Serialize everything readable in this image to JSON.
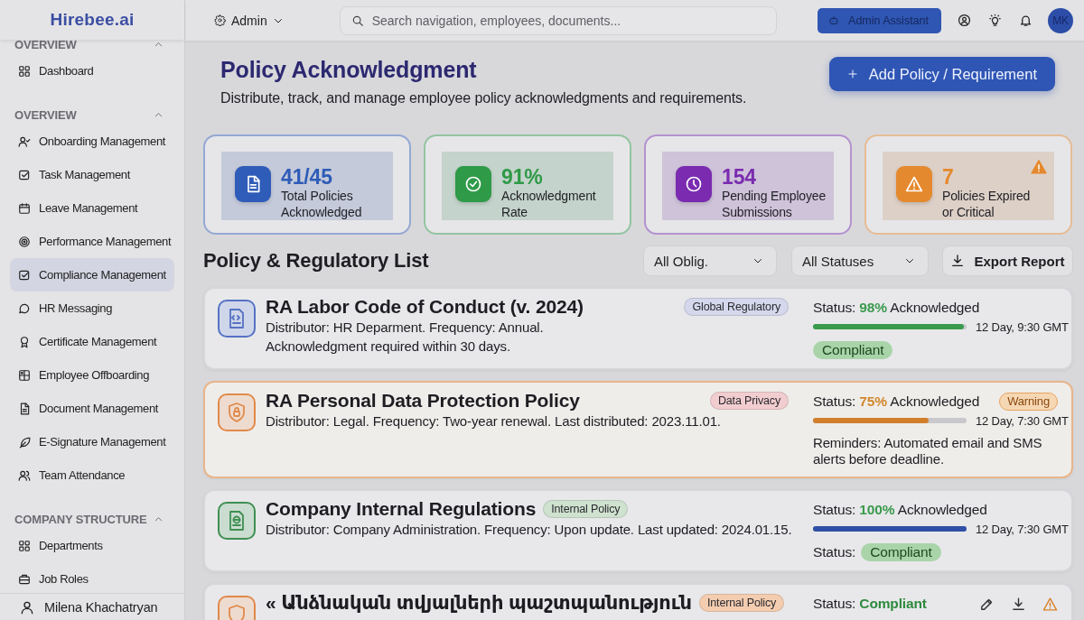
{
  "sidebar": {
    "logo": "Hirebee.ai",
    "sections": [
      {
        "title": "OVERVIEW",
        "expanded": true,
        "items": [
          {
            "label": "Dashboard",
            "selected": false
          }
        ]
      },
      {
        "title": "OVERVIEW",
        "expanded": true,
        "items": [
          {
            "label": "Onboarding Management",
            "selected": false
          },
          {
            "label": "Task Management",
            "selected": false
          },
          {
            "label": "Leave Management",
            "selected": false
          },
          {
            "label": "Performance Management",
            "selected": false
          },
          {
            "label": "Compliance Management",
            "selected": true
          },
          {
            "label": "HR Messaging",
            "selected": false
          },
          {
            "label": "Certificate Management",
            "selected": false
          },
          {
            "label": "Employee Offboarding",
            "selected": false
          },
          {
            "label": "Document Management",
            "selected": false
          },
          {
            "label": "E-Signature Management",
            "selected": false
          },
          {
            "label": "Team Attendance",
            "selected": false
          }
        ]
      },
      {
        "title": "COMPANY STRUCTURE",
        "expanded": true,
        "items": [
          {
            "label": "Departments",
            "selected": false
          },
          {
            "label": "Job Roles",
            "selected": false
          }
        ]
      }
    ],
    "user": "Milena Khachatryan"
  },
  "topbar": {
    "role": "Admin",
    "search": {
      "placeholder": "Search navigation, employees, documents..."
    },
    "assistant_button": "Admin Assistant",
    "avatar": "MK"
  },
  "header": {
    "title": "Policy Acknowledgment",
    "subtitle": "Distribute, track, and manage employee policy acknowledgments and requirements.",
    "add_button": "Add Policy / Requirement"
  },
  "stats": [
    {
      "kind": "document",
      "color": "#2f5cb8",
      "value": "41/45",
      "label": "Total Policies\nAcknowledged",
      "alert": false
    },
    {
      "kind": "check",
      "color": "#2f9a48",
      "value": "91%",
      "label": "Acknowledgment\nRate",
      "alert": false
    },
    {
      "kind": "clock",
      "color": "#7a2bb0",
      "value": "154",
      "label": "Pending Employee\nSubmissions",
      "alert": false
    },
    {
      "kind": "warning",
      "color": "#e5892e",
      "value": "7",
      "label": "Policies Expired\nor Critical",
      "alert": true
    }
  ],
  "list": {
    "title": "Policy & Regulatory List",
    "filters": [
      "All Oblig.",
      "All Statuses"
    ],
    "export_button": "Export Report",
    "policies": [
      {
        "kind": "code",
        "color": "#5572c4",
        "highlighted": false,
        "title": "RA Labor Code of Conduct (v. 2024)",
        "tag": {
          "label": "Global Regulatory",
          "color": "#d5d8ec",
          "inline": false
        },
        "description": "Distributor: HR Deparment. Frequency: Annual.\nAcknowledgment required within 30 days.",
        "status": {
          "text": "Status: **98%** Acknowledged",
          "color": "#3a9a4c"
        },
        "actions": false,
        "progress": {
          "level": 0.98,
          "color": "#3a9a4c"
        },
        "time": "12 Day, 9:30 GMT",
        "pill": "Compliant"
      },
      {
        "kind": "lock",
        "color": "#e08a4a",
        "highlighted": true,
        "title": "RA Personal Data Protection Policy",
        "tag": {
          "label": "Data Privacy",
          "color": "#f1cdd0",
          "inline": false
        },
        "description": "Distributor: Legal. Frequency: Two-year renewal. Last distributed: 2023.11.01.",
        "status": {
          "text": "Status: **75%** Acknowledged",
          "color": "#d0872c"
        },
        "badge": "Warning",
        "actions": false,
        "progress": {
          "level": 0.75,
          "color": "#d27f2c"
        },
        "time": "12 Day, 7:30 GMT",
        "note": "Reminders: Automated email and SMS\nalerts before deadline."
      },
      {
        "kind": "globe",
        "color": "#3f8f52",
        "highlighted": false,
        "title": "Company Internal Regulations",
        "tag": {
          "label": "Internal Policy",
          "color": "#cfe2cf",
          "inline": true
        },
        "description": "Distributor: Company Administration. Frequency: Upon update. Last updated: 2024.01.15.",
        "status": {
          "text": "Status: **100%** Acknowledged",
          "color": "#3a9a4c"
        },
        "actions": false,
        "progress": {
          "level": 1,
          "color": "#2f4fa6"
        },
        "time": "12 Day, 7:30 GMT",
        "pill_label": "Status:",
        "pill": "Compliant"
      },
      {
        "kind": "shield",
        "color": "#e0894a",
        "highlighted": false,
        "title": "« Անձնական տվյալների պաշտպանություն",
        "tag": {
          "label": "Internal Policy",
          "color": "#f4cdb0",
          "inline": true
        },
        "status": {
          "text": "Status: **Compliant**",
          "color": "#2f8a3e"
        },
        "actions": true
      }
    ]
  }
}
